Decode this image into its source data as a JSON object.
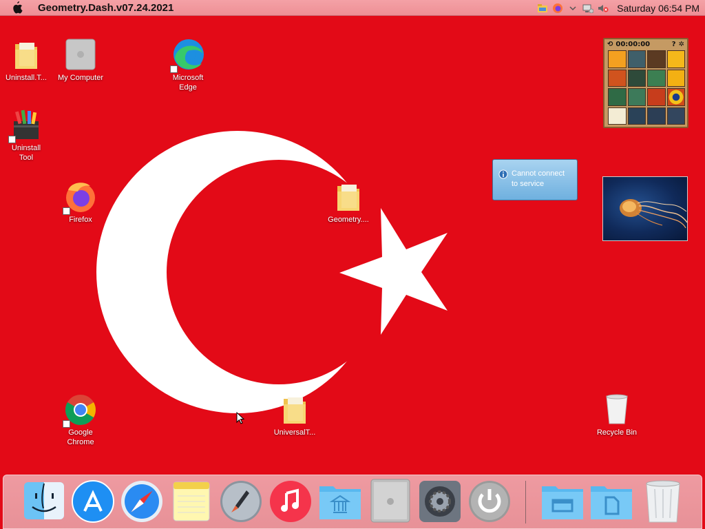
{
  "menubar": {
    "app_title": "Geometry.Dash.v07.24.2021",
    "clock": "Saturday 06:54 PM"
  },
  "desktop": {
    "icons": [
      {
        "label": "Uninstall.T...",
        "icon": "folder-icon"
      },
      {
        "label": "My Computer",
        "icon": "computer-icon"
      },
      {
        "label": "Microsoft\nEdge",
        "icon": "edge-icon"
      },
      {
        "label": "Uninstall\nTool",
        "icon": "uninstall-tool-icon"
      },
      {
        "label": "Firefox",
        "icon": "firefox-icon"
      },
      {
        "label": "Geometry....",
        "icon": "folder-icon"
      },
      {
        "label": "Google\nChrome",
        "icon": "chrome-icon"
      },
      {
        "label": "UniversalT...",
        "icon": "folder-icon"
      },
      {
        "label": "Recycle Bin",
        "icon": "recycle-bin-icon"
      }
    ]
  },
  "widgets": {
    "puzzle": {
      "timer": "00:00:00"
    },
    "notification": {
      "text": "Cannot connect\nto service"
    }
  },
  "dock": {
    "items": [
      "finder-icon",
      "app-store-icon",
      "safari-icon",
      "notes-icon",
      "launchpad-icon",
      "music-icon",
      "applications-folder-icon",
      "mac-pro-icon",
      "system-preferences-icon",
      "power-icon",
      "downloads-folder-icon",
      "documents-folder-icon",
      "trash-icon"
    ]
  },
  "colors": {
    "flag_red": "#e30a17",
    "flag_white": "#ffffff"
  }
}
